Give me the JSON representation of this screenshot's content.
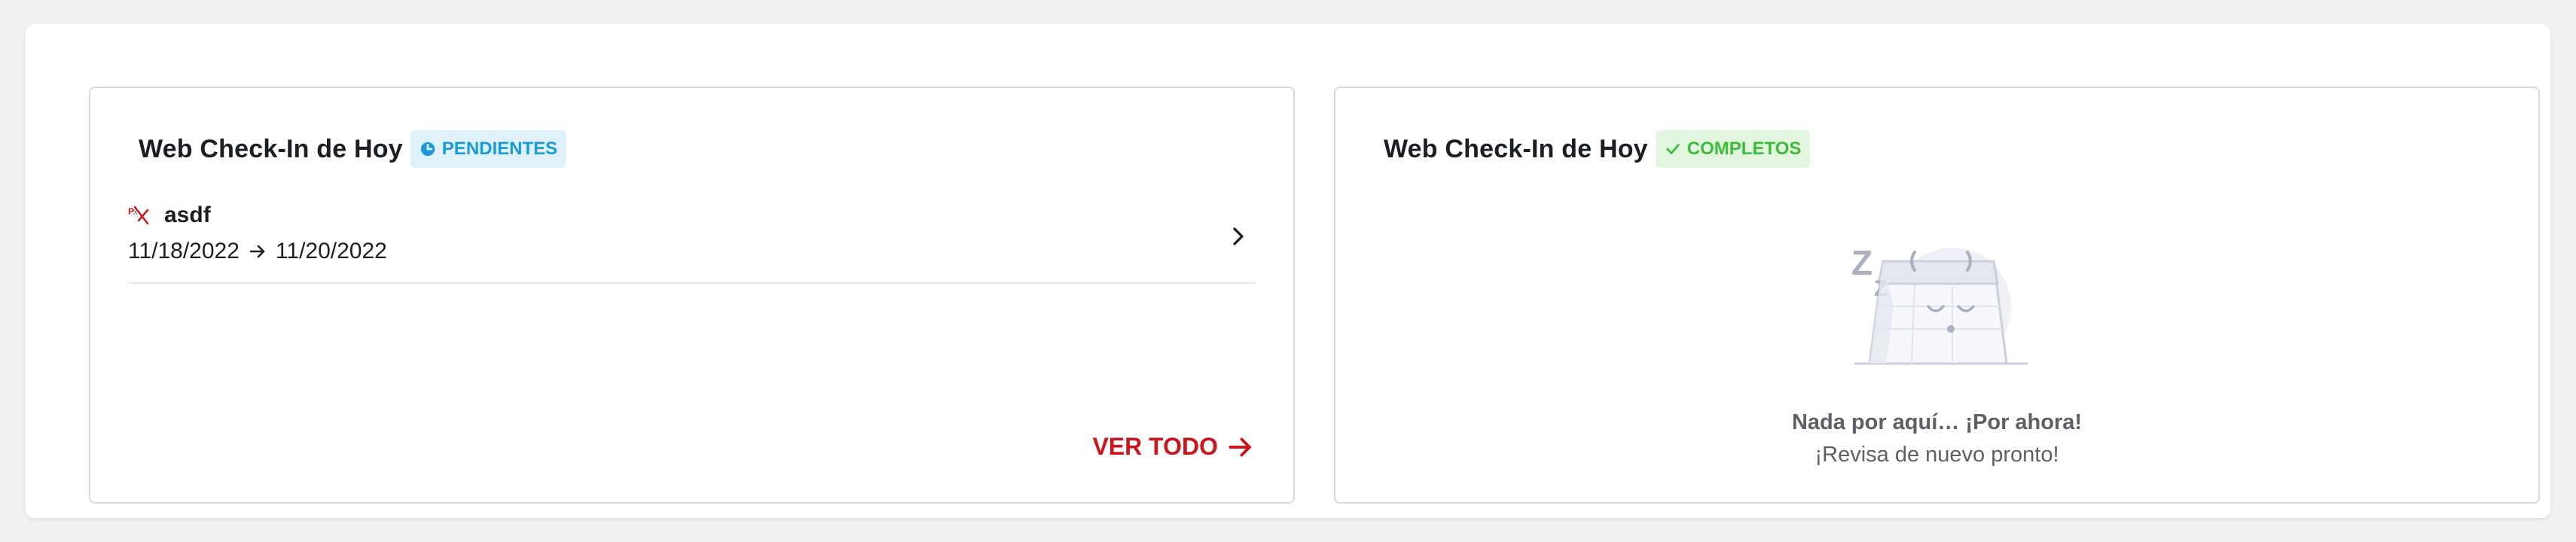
{
  "pending_card": {
    "title": "Web Check-In de Hoy",
    "badge_label": "PENDIENTES",
    "items": [
      {
        "name": "asdf",
        "check_in": "11/18/2022",
        "check_out": "11/20/2022",
        "icon": "pms-logo-icon"
      }
    ],
    "see_all_label": "VER TODO"
  },
  "complete_card": {
    "title": "Web Check-In de Hoy",
    "badge_label": "COMPLETOS",
    "empty_title": "Nada por aquí… ¡Por ahora!",
    "empty_subtitle": "¡Revisa de nuevo pronto!",
    "illustration": "sleeping-calendar-icon"
  },
  "colors": {
    "accent_red": "#c8161d",
    "pending_blue": "#1a9bd7",
    "pending_bg": "#dff2fb",
    "complete_green": "#3dbb3b",
    "complete_bg": "#e2f6df"
  }
}
